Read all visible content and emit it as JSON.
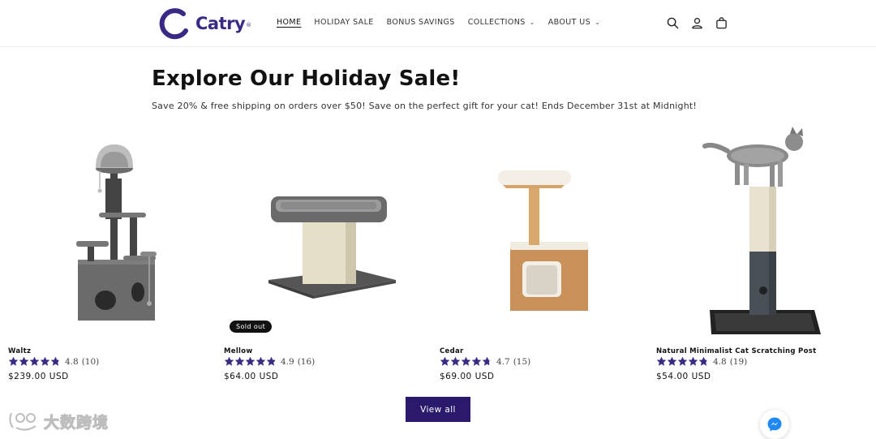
{
  "brand": {
    "name": "Catry",
    "accent": "#3b2a85",
    "button_color": "#2b1a6b"
  },
  "nav": {
    "items": [
      {
        "label": "HOME",
        "active": true,
        "has_dropdown": false
      },
      {
        "label": "HOLIDAY SALE",
        "active": false,
        "has_dropdown": false
      },
      {
        "label": "BONUS SAVINGS",
        "active": false,
        "has_dropdown": false
      },
      {
        "label": "COLLECTIONS",
        "active": false,
        "has_dropdown": true
      },
      {
        "label": "ABOUT US",
        "active": false,
        "has_dropdown": true
      }
    ]
  },
  "header_icons": [
    "search-icon",
    "account-icon",
    "cart-icon"
  ],
  "main": {
    "title": "Explore Our Holiday Sale!",
    "subtitle": "Save 20% & free shipping on orders over $50! Save on the perfect gift for your cat! Ends December 31st at Midnight!",
    "view_all_label": "View all"
  },
  "products": [
    {
      "name": "Waltz",
      "rating": "4.8",
      "reviews": "(10)",
      "stars": 4.8,
      "price": "$239.00 USD",
      "badge": ""
    },
    {
      "name": "Mellow",
      "rating": "4.9",
      "reviews": "(16)",
      "stars": 4.9,
      "price": "$64.00 USD",
      "badge": "Sold out"
    },
    {
      "name": "Cedar",
      "rating": "4.7",
      "reviews": "(15)",
      "stars": 4.7,
      "price": "$69.00 USD",
      "badge": ""
    },
    {
      "name": "Natural Minimalist Cat Scratching Post",
      "rating": "4.8",
      "reviews": "(19)",
      "stars": 4.8,
      "price": "$54.00 USD",
      "badge": ""
    }
  ],
  "watermark": {
    "text": "大数跨境"
  },
  "star_color": "#3b2a85"
}
